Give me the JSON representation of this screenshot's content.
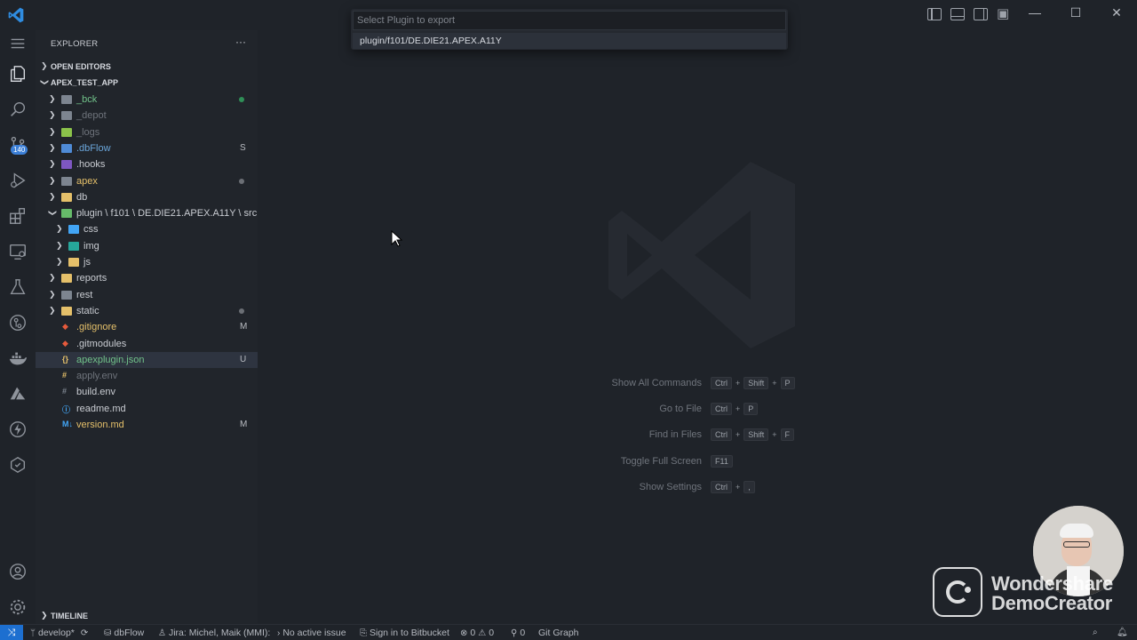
{
  "titlebar": {
    "window_controls": {
      "minimize": "—",
      "maximize": "☐",
      "close": "✕"
    }
  },
  "activitybar": {
    "items": [
      "explorer-icon",
      "search-icon",
      "source-control-icon",
      "run-debug-icon",
      "extensions-icon",
      "remote-explorer-icon",
      "testing-icon",
      "gitlens-icon",
      "docker-icon",
      "azure-icon",
      "thunder-icon",
      "git-graph-icon",
      "accounts-icon",
      "settings-gear-icon"
    ],
    "scm_badge": "140"
  },
  "sidebar": {
    "title": "EXPLORER",
    "more": "···",
    "open_editors": "OPEN EDITORS",
    "workspace": "APEX_TEST_APP",
    "tree": [
      {
        "name": "_bck",
        "status": "",
        "dot": "#2f8f57",
        "color": "#71c28a"
      },
      {
        "name": "_depot",
        "status": "",
        "dot": "",
        "color": "#6e737b"
      },
      {
        "name": "_logs",
        "status": "",
        "dot": "",
        "color": "#6e737b"
      },
      {
        "name": ".dbFlow",
        "status": "S",
        "dot": "",
        "color": "#6aa5d9"
      },
      {
        "name": ".hooks",
        "status": "",
        "dot": "",
        "color": "#c9ccd2"
      },
      {
        "name": "apex",
        "status": "",
        "dot": "#6b6f75",
        "color": "#e5c06a"
      },
      {
        "name": "db",
        "status": "",
        "dot": "",
        "color": "#c9ccd2"
      },
      {
        "name": "plugin \\ f101 \\ DE.DIE21.APEX.A11Y \\ src",
        "status": "",
        "dot": "",
        "color": "#c9ccd2"
      },
      {
        "name": "css",
        "status": "",
        "dot": "",
        "color": "#c9ccd2"
      },
      {
        "name": "img",
        "status": "",
        "dot": "",
        "color": "#c9ccd2"
      },
      {
        "name": "js",
        "status": "",
        "dot": "",
        "color": "#c9ccd2"
      },
      {
        "name": "reports",
        "status": "",
        "dot": "",
        "color": "#c9ccd2"
      },
      {
        "name": "rest",
        "status": "",
        "dot": "",
        "color": "#c9ccd2"
      },
      {
        "name": "static",
        "status": "",
        "dot": "#6b6f75",
        "color": "#c9ccd2"
      },
      {
        "name": ".gitignore",
        "status": "M",
        "dot": "",
        "color": "#e5c06a"
      },
      {
        "name": ".gitmodules",
        "status": "",
        "dot": "",
        "color": "#c9ccd2"
      },
      {
        "name": "apexplugin.json",
        "status": "U",
        "dot": "",
        "color": "#71c28a"
      },
      {
        "name": "apply.env",
        "status": "",
        "dot": "",
        "color": "#6e737b"
      },
      {
        "name": "build.env",
        "status": "",
        "dot": "",
        "color": "#c9ccd2"
      },
      {
        "name": "readme.md",
        "status": "",
        "dot": "",
        "color": "#c9ccd2"
      },
      {
        "name": "version.md",
        "status": "M",
        "dot": "",
        "color": "#e5c06a"
      }
    ],
    "timeline": "TIMELINE"
  },
  "quickpick": {
    "placeholder": "Select Plugin to export",
    "items": [
      "plugin/f101/DE.DIE21.APEX.A11Y"
    ]
  },
  "shortcuts": [
    {
      "label": "Show All Commands",
      "keys": [
        "Ctrl",
        "Shift",
        "P"
      ]
    },
    {
      "label": "Go to File",
      "keys": [
        "Ctrl",
        "P"
      ]
    },
    {
      "label": "Find in Files",
      "keys": [
        "Ctrl",
        "Shift",
        "F"
      ]
    },
    {
      "label": "Toggle Full Screen",
      "keys": [
        "F11"
      ]
    },
    {
      "label": "Show Settings",
      "keys": [
        "Ctrl",
        ","
      ]
    }
  ],
  "watermark": {
    "line1": "Wondershare",
    "line2": "DemoCreator"
  },
  "statusbar": {
    "remote": "⤨",
    "branch": "develop*",
    "sync": "⟳",
    "dbflow": "dbFlow",
    "jira": "Jira: Michel, Maik (MMI):",
    "issue": "No active issue",
    "bitbucket": "Sign in to Bitbucket",
    "errors": "0",
    "warnings": "0",
    "ports": "0",
    "gitgraph": "Git Graph"
  },
  "colors": {
    "accent": "#1d6fd0",
    "background": "#1f2329",
    "sidebar": "#21252b"
  }
}
